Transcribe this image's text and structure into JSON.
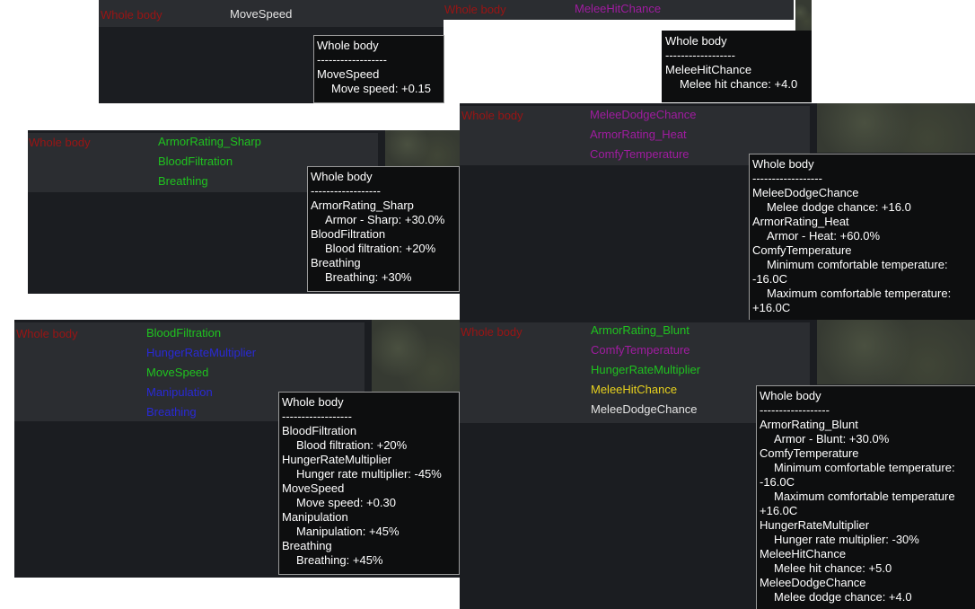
{
  "panel1": {
    "header": "Whole body",
    "stats": [
      "MoveSpeed"
    ],
    "tooltip": {
      "title": "Whole body",
      "sep": "------------------",
      "lines": [
        "MoveSpeed",
        "Move speed: +0.15"
      ]
    }
  },
  "panel2": {
    "header": "Whole body",
    "stats": [
      "MeleeHitChance"
    ],
    "tooltip": {
      "title": "Whole body",
      "sep": "------------------",
      "lines": [
        "MeleeHitChance",
        "Melee hit chance: +4.0"
      ]
    }
  },
  "panel3": {
    "header": "Whole body",
    "stats": [
      "ArmorRating_Sharp",
      "BloodFiltration",
      "Breathing"
    ],
    "tooltip": {
      "title": "Whole body",
      "sep": "------------------",
      "lines": [
        "ArmorRating_Sharp",
        "Armor - Sharp: +30.0%",
        "BloodFiltration",
        "Blood filtration: +20%",
        "Breathing",
        "Breathing: +30%"
      ]
    }
  },
  "panel4": {
    "header": "Whole body",
    "stats": [
      "MeleeDodgeChance",
      "ArmorRating_Heat",
      "ComfyTemperature"
    ],
    "tooltip": {
      "title": "Whole body",
      "sep": "------------------",
      "lines": [
        "MeleeDodgeChance",
        "Melee dodge chance: +16.0",
        "ArmorRating_Heat",
        "Armor - Heat: +60.0%",
        "ComfyTemperature",
        "Minimum comfortable temperature:",
        "-16.0C",
        "Maximum comfortable temperature:",
        "+16.0C"
      ]
    }
  },
  "panel5": {
    "header": "Whole body",
    "stats": [
      "BloodFiltration",
      "HungerRateMultiplier",
      "MoveSpeed",
      "Manipulation",
      "Breathing"
    ],
    "tooltip": {
      "title": "Whole body",
      "sep": "------------------",
      "lines": [
        "BloodFiltration",
        "Blood filtration: +20%",
        "HungerRateMultiplier",
        "Hunger rate multiplier: -45%",
        "MoveSpeed",
        "Move speed: +0.30",
        "Manipulation",
        "Manipulation: +45%",
        "Breathing",
        "Breathing: +45%"
      ]
    }
  },
  "panel6": {
    "header": "Whole body",
    "stats": [
      "ArmorRating_Blunt",
      "ComfyTemperature",
      "HungerRateMultiplier",
      "MeleeHitChance",
      "MeleeDodgeChance"
    ],
    "tooltip": {
      "title": "Whole body",
      "sep": "------------------",
      "lines": [
        "ArmorRating_Blunt",
        "Armor - Blunt: +30.0%",
        "ComfyTemperature",
        "Minimum comfortable temperature:",
        "-16.0C",
        "Maximum comfortable temperature",
        "+16.0C",
        "HungerRateMultiplier",
        "Hunger rate multiplier: -30%",
        "MeleeHitChance",
        "Melee hit chance: +5.0",
        "MeleeDodgeChance",
        "Melee dodge chance: +4.0"
      ]
    }
  },
  "colors": {
    "header_red": "#9a1414",
    "green": "#1fc31f",
    "blue": "#2929d6",
    "purple": "#a01ca0",
    "yellow": "#e8d21e",
    "white": "#e4e4e4"
  }
}
